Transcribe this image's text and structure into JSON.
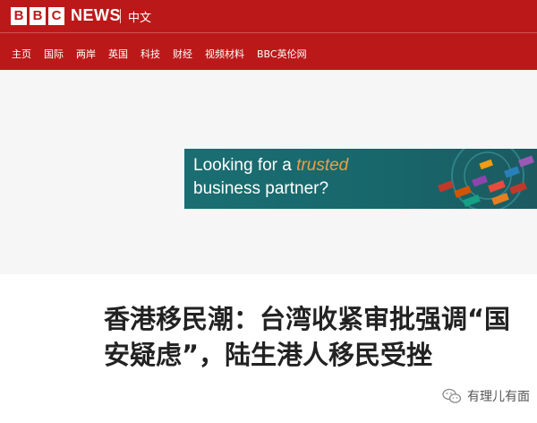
{
  "header": {
    "logo_letters": [
      "B",
      "B",
      "C"
    ],
    "brand": "NEWS",
    "language": "中文",
    "brand_color": "#bb1919"
  },
  "nav": {
    "items": [
      "主页",
      "国际",
      "两岸",
      "英国",
      "科技",
      "财经",
      "视频材料",
      "BBC英伦网"
    ]
  },
  "ad": {
    "line1_prefix": "Looking for a",
    "line1_highlight": "trusted",
    "line2": "business partner?",
    "accent_color": "#e9a04a",
    "bg_color": "#1a6e72"
  },
  "article": {
    "headline": "香港移民潮：台湾收紧审批强调“国安疑虑”，陆生港人移民受挫"
  },
  "watermark": {
    "icon": "wechat-icon",
    "text": "有理儿有面"
  }
}
